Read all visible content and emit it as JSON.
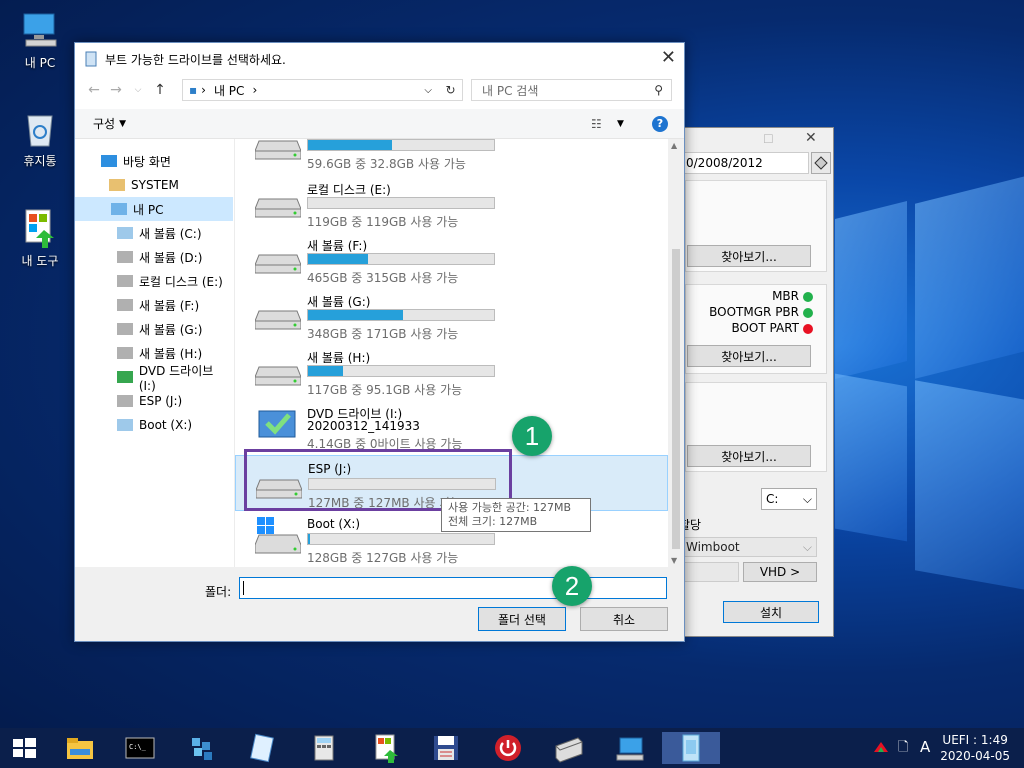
{
  "desktop": {
    "icons": [
      "내 PC",
      "휴지통",
      "내 도구"
    ]
  },
  "bgwin": {
    "os_text": "0/2008/2012",
    "browse1": "찾아보기...",
    "mbr": "MBR",
    "bootmgr": "BOOTMGR PBR",
    "bootpart": "BOOT PART",
    "browse2": "찾아보기...",
    "browse3": "찾아보기...",
    "drive_select": "C:",
    "alloc_label": "할당",
    "wimboot_select": "Wimboot",
    "vhd_button": "VHD >",
    "install_button": "설치",
    "colors": {
      "green": "#22b14c",
      "red": "#e81123"
    }
  },
  "dialog": {
    "title": "부트 가능한 드라이브를 선택하세요.",
    "address": "내 PC",
    "search_placeholder": "내 PC 검색",
    "organize": "구성",
    "nav": {
      "desktop": "바탕 화면",
      "system": "SYSTEM",
      "mypc": "내 PC",
      "c": "새 볼륨 (C:)",
      "d": "새 볼륨 (D:)",
      "e": "로컬 디스크 (E:)",
      "f": "새 볼륨 (F:)",
      "g": "새 볼륨 (G:)",
      "h": "새 볼륨 (H:)",
      "i": "DVD 드라이브 (I:)",
      "j": "ESP (J:)",
      "x": "Boot (X:)"
    },
    "drives": {
      "d": {
        "free": "59.6GB 중 32.8GB 사용 가능",
        "used_fraction": 0.45
      },
      "e": {
        "name": "로컬 디스크 (E:)",
        "free": "119GB 중 119GB 사용 가능",
        "used_fraction": 0.0
      },
      "f": {
        "name": "새 볼륨 (F:)",
        "free": "465GB 중 315GB 사용 가능",
        "used_fraction": 0.32
      },
      "g": {
        "name": "새 볼륨 (G:)",
        "free": "348GB 중 171GB 사용 가능",
        "used_fraction": 0.51
      },
      "h": {
        "name": "새 볼륨 (H:)",
        "free": "117GB 중 95.1GB 사용 가능",
        "used_fraction": 0.19
      },
      "i": {
        "name": "DVD 드라이브 (I:)",
        "label": "20200312_141933",
        "free": "4.14GB 중 0바이트 사용 가능"
      },
      "j": {
        "name": "ESP (J:)",
        "free": "127MB 중 127MB 사용 가능",
        "used_fraction": 0.0
      },
      "x": {
        "name": "Boot (X:)",
        "free": "128GB 중 127GB 사용 가능",
        "used_fraction": 0.01
      }
    },
    "tooltip_line1": "사용 가능한 공간: 127MB",
    "tooltip_line2": "전체 크기: 127MB",
    "folder_label": "폴더:",
    "folder_value": "",
    "select_button": "폴더 선택",
    "cancel_button": "취소"
  },
  "markers": {
    "one": "1",
    "two": "2"
  },
  "tray": {
    "lang": "A",
    "mode_time": "UEFI : 1:49",
    "date": "2020-04-05"
  }
}
